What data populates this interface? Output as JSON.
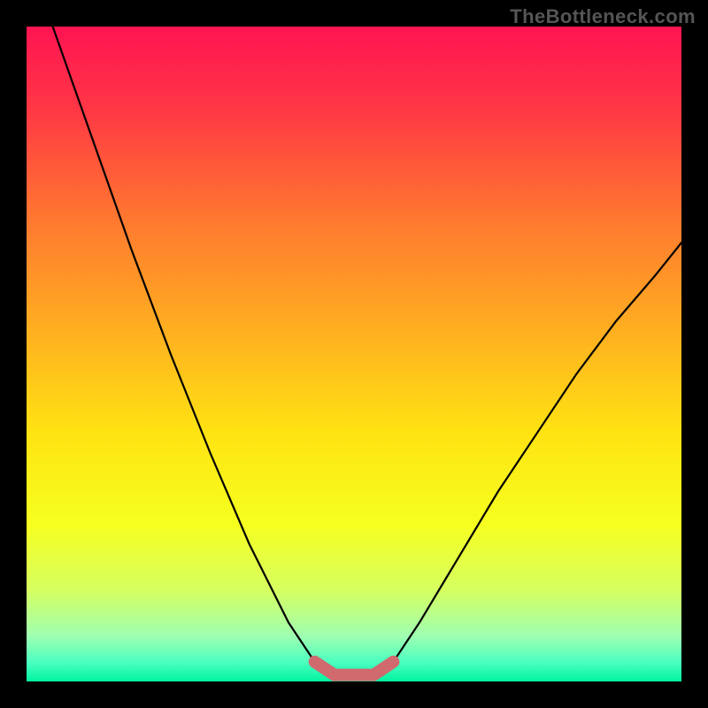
{
  "watermark": "TheBottleneck.com",
  "chart_data": {
    "type": "line",
    "title": "",
    "xlabel": "",
    "ylabel": "",
    "xlim": [
      0,
      100
    ],
    "ylim": [
      0,
      100
    ],
    "grid": false,
    "legend": false,
    "background": {
      "type": "vertical-gradient",
      "stops": [
        {
          "pos": 0.0,
          "color": "#ff1452"
        },
        {
          "pos": 0.12,
          "color": "#ff3545"
        },
        {
          "pos": 0.3,
          "color": "#ff7a2f"
        },
        {
          "pos": 0.48,
          "color": "#ffb41f"
        },
        {
          "pos": 0.62,
          "color": "#ffe312"
        },
        {
          "pos": 0.76,
          "color": "#f6ff20"
        },
        {
          "pos": 0.86,
          "color": "#d6ff60"
        },
        {
          "pos": 0.93,
          "color": "#9fffb0"
        },
        {
          "pos": 0.97,
          "color": "#4dffc0"
        },
        {
          "pos": 1.0,
          "color": "#00f5a0"
        }
      ]
    },
    "curve": {
      "note": "V-shaped bottleneck curve; y is distance from 0 (optimal) to 100 (worst).",
      "points": [
        {
          "x": 4,
          "y": 100
        },
        {
          "x": 10,
          "y": 83
        },
        {
          "x": 16,
          "y": 66
        },
        {
          "x": 22,
          "y": 50
        },
        {
          "x": 28,
          "y": 35
        },
        {
          "x": 34,
          "y": 21
        },
        {
          "x": 40,
          "y": 9
        },
        {
          "x": 44,
          "y": 3
        },
        {
          "x": 47,
          "y": 1
        },
        {
          "x": 50,
          "y": 1
        },
        {
          "x": 53,
          "y": 1
        },
        {
          "x": 56,
          "y": 3
        },
        {
          "x": 60,
          "y": 9
        },
        {
          "x": 66,
          "y": 19
        },
        {
          "x": 72,
          "y": 29
        },
        {
          "x": 78,
          "y": 38
        },
        {
          "x": 84,
          "y": 47
        },
        {
          "x": 90,
          "y": 55
        },
        {
          "x": 96,
          "y": 62
        },
        {
          "x": 100,
          "y": 67
        }
      ]
    },
    "highlight_band": {
      "note": "Pink overlay marking the optimal (bottom) portion of the curve.",
      "x_range": [
        42,
        58
      ],
      "y_range": [
        0,
        6
      ],
      "color": "#d06a6f"
    }
  }
}
